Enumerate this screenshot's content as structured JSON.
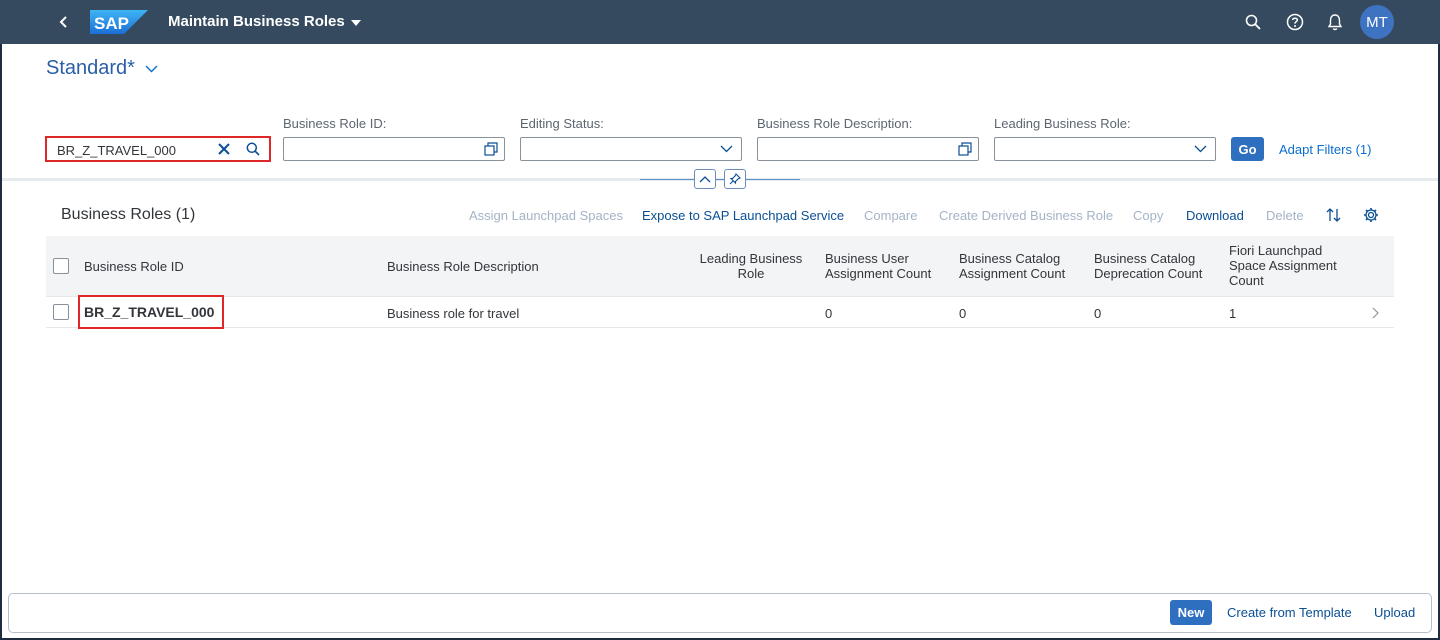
{
  "shell": {
    "app_title": "Maintain Business Roles",
    "logo_text": "SAP",
    "user_initials": "MT",
    "icons": [
      "back-icon",
      "search-icon",
      "help-icon",
      "bell-icon"
    ]
  },
  "variant": {
    "title": "Standard*"
  },
  "filters": {
    "search_value": "BR_Z_TRAVEL_000",
    "business_role_id_label": "Business Role ID:",
    "editing_status_label": "Editing Status:",
    "business_role_description_label": "Business Role Description:",
    "leading_business_role_label": "Leading Business Role:",
    "go_label": "Go",
    "adapt_filters_label": "Adapt Filters (1)"
  },
  "table": {
    "title": "Business Roles (1)",
    "toolbar": {
      "assign_launchpad_spaces": "Assign Launchpad Spaces",
      "expose": "Expose to SAP Launchpad Service",
      "compare": "Compare",
      "create_derived": "Create Derived Business Role",
      "copy": "Copy",
      "download": "Download",
      "delete": "Delete"
    },
    "columns": {
      "id": "Business Role ID",
      "description": "Business Role Description",
      "leading_1": "Leading Business",
      "leading_2": "Role",
      "user_count_1": "Business User",
      "user_count_2": "Assignment Count",
      "catalog_count_1": "Business Catalog",
      "catalog_count_2": "Assignment Count",
      "deprecation_1": "Business Catalog",
      "deprecation_2": "Deprecation Count",
      "fiori_1": "Fiori Launchpad",
      "fiori_2": "Space Assignment",
      "fiori_3": "Count"
    },
    "rows": [
      {
        "id": "BR_Z_TRAVEL_000",
        "description": "Business role for travel",
        "leading": "",
        "user_count": "0",
        "catalog_count": "0",
        "deprecation_count": "0",
        "space_count": "1"
      }
    ]
  },
  "footer": {
    "new_label": "New",
    "create_from_template_label": "Create from Template",
    "upload_label": "Upload"
  },
  "colors": {
    "shell_bg": "#354a5f",
    "accent": "#0a6ed1",
    "emphasized_button": "#2f6fbf",
    "highlight_border": "#e02727"
  }
}
